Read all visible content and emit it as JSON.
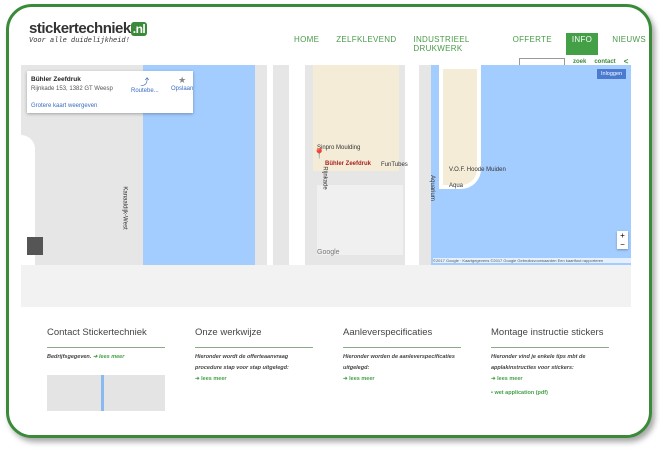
{
  "header": {
    "logo_text": "stickertechniek",
    "logo_suffix": ".nl",
    "tagline": "Voor alle duidelijkheid!"
  },
  "nav": [
    "HOME",
    "ZELFKLEVEND",
    "INDUSTRIEEL DRUKWERK",
    "OFFERTE",
    "INFO",
    "NIEUWS"
  ],
  "nav_active": "INFO",
  "util": {
    "search_label": "zoek",
    "contact_label": "contact"
  },
  "map": {
    "place_name": "Bühler Zeefdruk",
    "address": "Rijnkade 153, 1382 GT Weesp",
    "route_label": "Routebe...",
    "save_label": "Opslaan",
    "larger_map": "Grotere kaart weergeven",
    "login": "Inloggen",
    "labels": {
      "moulding": "Sinpro Moulding",
      "marker": "Bühler Zeefdruk",
      "funtubes": "FunTubes",
      "vof": "V.O.F. Hoode Muiden",
      "aqua": "Aqua",
      "rijnkade": "Rijnkade",
      "aquarium": "Aquarium",
      "kanaal": "Kanaaldijk-West"
    },
    "google": "Google",
    "footer": "©2017 Google · Kaartgegevens ©2017 Google   Gebruiksvoorwaarden   Een kaartfout rapporteren",
    "zoom_in": "+",
    "zoom_out": "−"
  },
  "columns": [
    {
      "title": "Contact Stickertechniek",
      "text": "Bedrijfsgegeven.",
      "link": "lees meer"
    },
    {
      "title": "Onze werkwijze",
      "text": "Hieronder wordt de offerteaanvraag procedure stap voor stap uitgelegd:",
      "link": "lees meer"
    },
    {
      "title": "Aanleverspecificaties",
      "text": "Hieronder worden de aanleverspecificaties uitgelegd:",
      "link": "lees meer"
    },
    {
      "title": "Montage instructie stickers",
      "text": "Hieronder vind je enkele tips mbt de applakinstructies voor stickers:",
      "link": "lees meer",
      "extra": "wet application (pdf)"
    }
  ],
  "colors": {
    "brand": "#43a047",
    "water": "#a3ccff"
  }
}
